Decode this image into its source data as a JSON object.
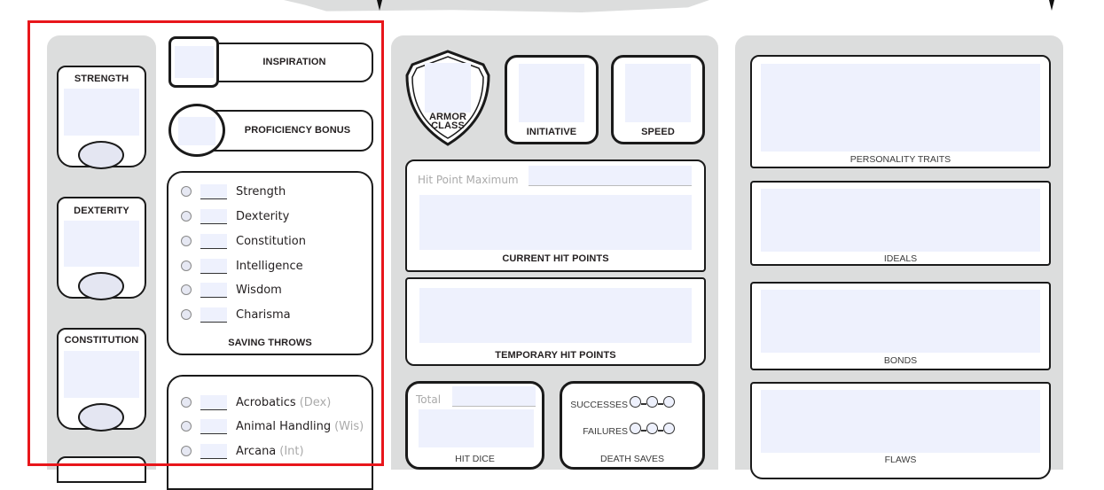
{
  "abilities": [
    {
      "name": "STRENGTH"
    },
    {
      "name": "DEXTERITY"
    },
    {
      "name": "CONSTITUTION"
    }
  ],
  "inspiration": {
    "label": "INSPIRATION"
  },
  "proficiency_bonus": {
    "label": "PROFICIENCY BONUS"
  },
  "saving_throws": {
    "title": "SAVING THROWS",
    "items": [
      {
        "label": "Strength"
      },
      {
        "label": "Dexterity"
      },
      {
        "label": "Constitution"
      },
      {
        "label": "Intelligence"
      },
      {
        "label": "Wisdom"
      },
      {
        "label": "Charisma"
      }
    ]
  },
  "skills": {
    "items": [
      {
        "label": "Acrobatics",
        "ability": "(Dex)"
      },
      {
        "label": "Animal Handling",
        "ability": "(Wis)"
      },
      {
        "label": "Arcana",
        "ability": "(Int)"
      }
    ]
  },
  "combat": {
    "armor_class": "ARMOR CLASS",
    "armor_line1": "ARMOR",
    "armor_line2": "CLASS",
    "initiative": "INITIATIVE",
    "speed": "SPEED",
    "hp_max_label": "Hit Point Maximum",
    "current_hp": "CURRENT HIT POINTS",
    "temp_hp": "TEMPORARY HIT POINTS",
    "hit_dice_total_label": "Total",
    "hit_dice": "HIT DICE",
    "death_saves": "DEATH SAVES",
    "successes": "SUCCESSES",
    "failures": "FAILURES"
  },
  "traits": {
    "personality": "PERSONALITY TRAITS",
    "ideals": "IDEALS",
    "bonds": "BONDS",
    "flaws": "FLAWS"
  },
  "colors": {
    "field": "#eef1fd",
    "panel_gray": "#dcdddd",
    "selection": "#e8161b"
  }
}
